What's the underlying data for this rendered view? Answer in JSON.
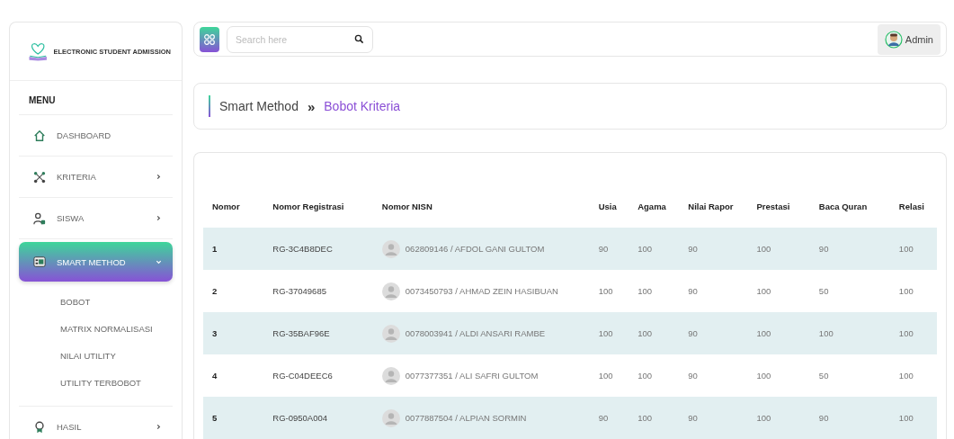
{
  "brand": {
    "name": "ELECTRONIC STUDENT ADMISSION"
  },
  "menu": {
    "heading": "MENU",
    "items": [
      {
        "label": "DASHBOARD",
        "kind": "link",
        "selected": false
      },
      {
        "label": "KRITERIA",
        "kind": "group",
        "selected": false,
        "expanded": false
      },
      {
        "label": "SISWA",
        "kind": "group",
        "selected": false,
        "expanded": false
      },
      {
        "label": "SMART METHOD",
        "kind": "group",
        "selected": true,
        "expanded": true,
        "children": [
          {
            "label": "BOBOT"
          },
          {
            "label": "MATRIX NORMALISASI"
          },
          {
            "label": "NILAI UTILITY"
          },
          {
            "label": "UTILITY TERBOBOT"
          }
        ]
      },
      {
        "label": "HASIL",
        "kind": "group",
        "selected": false,
        "expanded": false
      }
    ]
  },
  "topbar": {
    "search": {
      "placeholder": "Search here"
    },
    "user": "Admin"
  },
  "breadcrumb": {
    "parent": "Smart Method",
    "separator": "»",
    "current": "Bobot Kriteria"
  },
  "table": {
    "columns": [
      "Nomor",
      "Nomor Registrasi",
      "Nomor NISN",
      "Usia",
      "Agama",
      "Nilai Rapor",
      "Prestasi",
      "Baca Quran",
      "Relasi"
    ],
    "rows": [
      {
        "cells": [
          "1",
          "RG-3C4B8DEC",
          "062809146 / AFDOL GANI GULTOM",
          "90",
          "100",
          "90",
          "100",
          "90",
          "100"
        ]
      },
      {
        "cells": [
          "2",
          "RG-37049685",
          "0073450793 / AHMAD ZEIN HASIBUAN",
          "100",
          "100",
          "90",
          "100",
          "50",
          "100"
        ]
      },
      {
        "cells": [
          "3",
          "RG-35BAF96E",
          "0078003941 / ALDI ANSARI RAMBE",
          "100",
          "100",
          "90",
          "100",
          "100",
          "100"
        ]
      },
      {
        "cells": [
          "4",
          "RG-C04DEEC6",
          "0077377351 / ALI SAFRI GULTOM",
          "100",
          "100",
          "90",
          "100",
          "50",
          "100"
        ]
      },
      {
        "cells": [
          "5",
          "RG-0950A004",
          "0077887504 / ALPIAN SORMIN",
          "90",
          "100",
          "90",
          "100",
          "90",
          "100"
        ]
      }
    ]
  }
}
